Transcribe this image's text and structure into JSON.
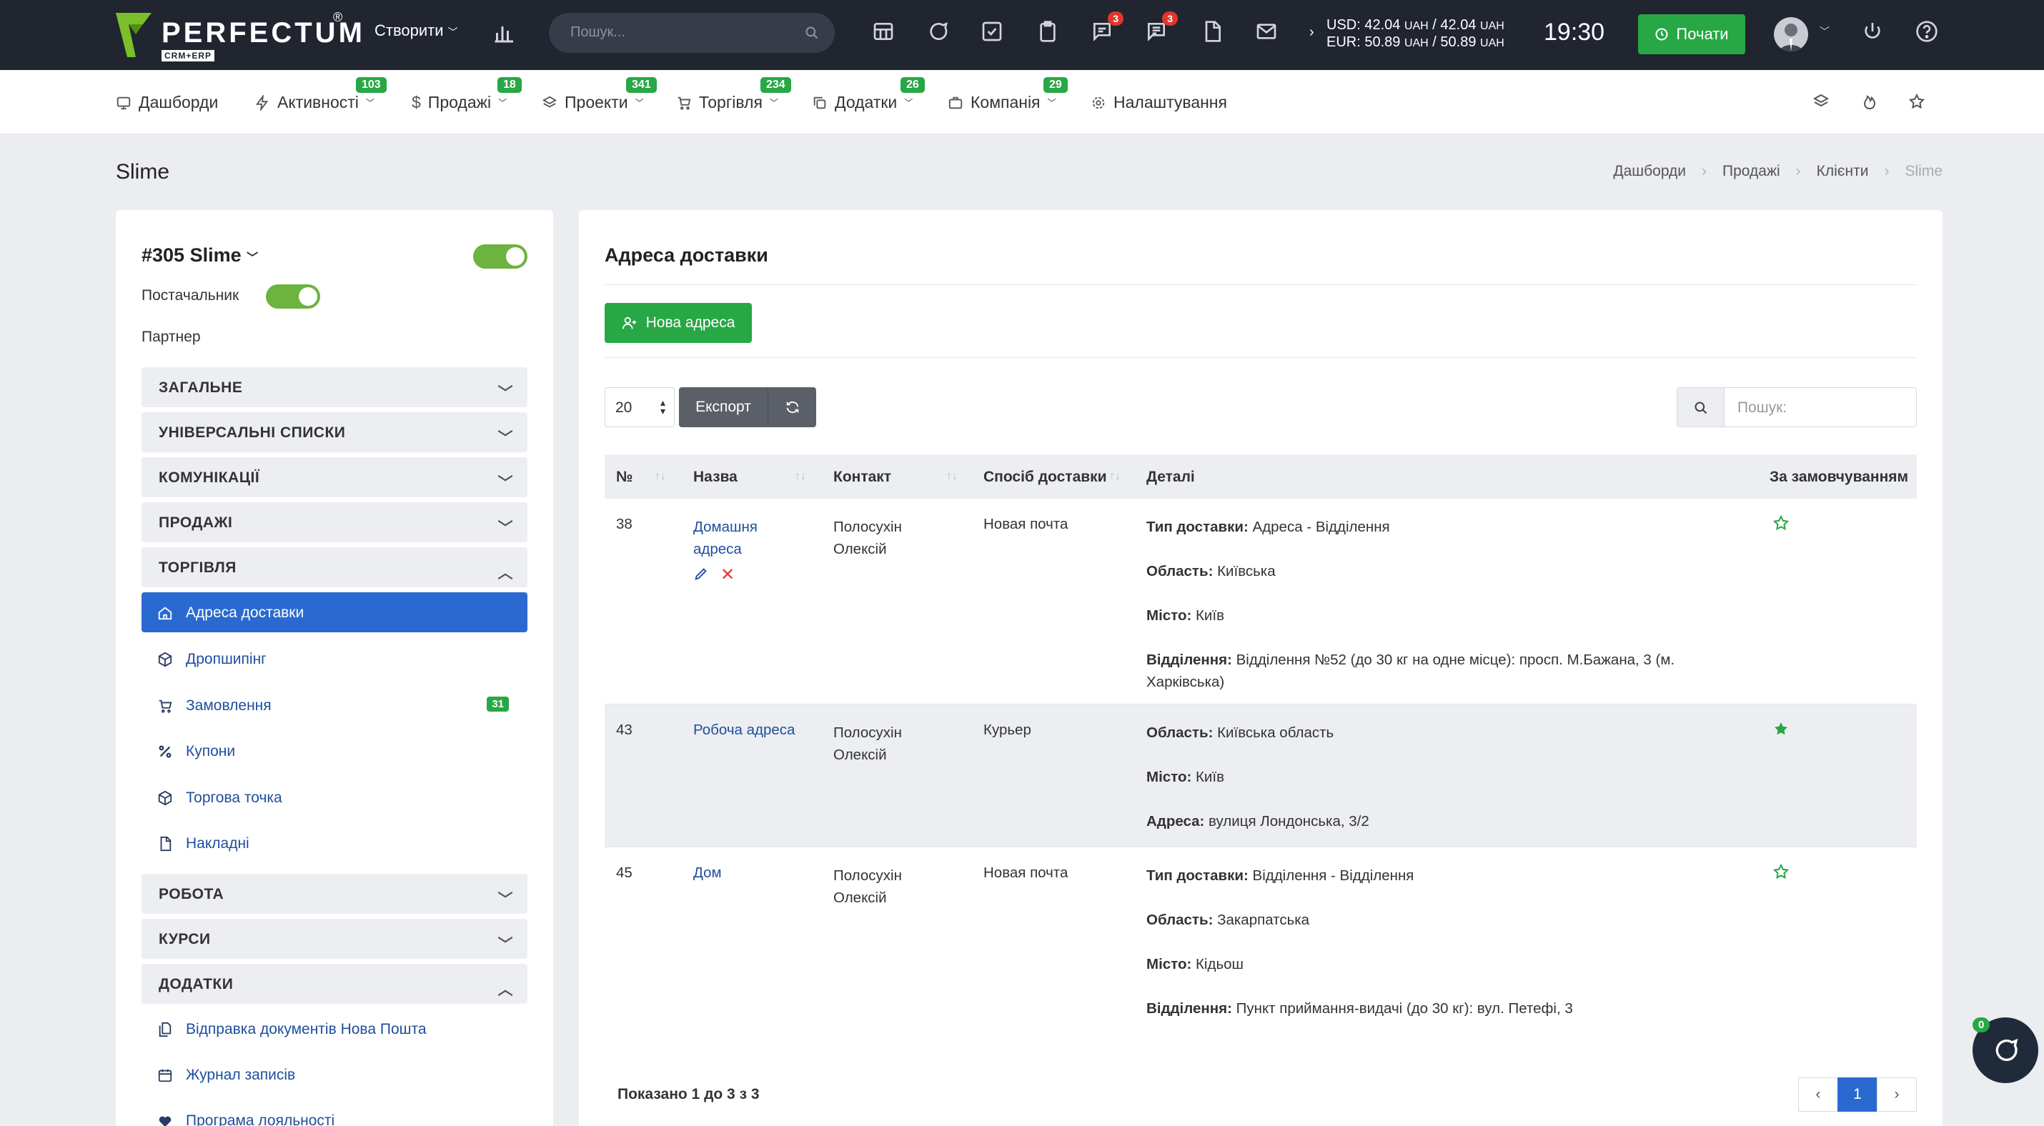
{
  "app": {
    "logo": "PERFECTUM",
    "logo_sub": "CRM+ERP",
    "logo_reg": "®",
    "create_label": "Створити",
    "search_placeholder": "Пошук...",
    "notif_badge_1": "3",
    "notif_badge_2": "3",
    "rate_usd": "USD: 42.04",
    "rate_usd_mid": " / 42.04 ",
    "rate_eur": "EUR: 50.89",
    "rate_eur_mid": " / 50.89 ",
    "uah": "UAH",
    "time": "19:30",
    "start_label": "Почати"
  },
  "nav": [
    {
      "label": "Дашборди",
      "badge": ""
    },
    {
      "label": "Активності",
      "badge": "103"
    },
    {
      "label": "Продажі",
      "badge": "18"
    },
    {
      "label": "Проекти",
      "badge": "341"
    },
    {
      "label": "Торгівля",
      "badge": "234"
    },
    {
      "label": "Додатки",
      "badge": "26"
    },
    {
      "label": "Компанія",
      "badge": "29"
    },
    {
      "label": "Налаштування",
      "badge": ""
    }
  ],
  "page": {
    "title": "Slime",
    "breadcrumbs": [
      "Дашборди",
      "Продажі",
      "Клієнти",
      "Slime"
    ]
  },
  "client": {
    "name": "#305 Slime",
    "supplier_label": "Постачальник",
    "partner_label": "Партнер"
  },
  "sidebar": {
    "sections": [
      "ЗАГАЛЬНЕ",
      "УНІВЕРСАЛЬНІ СПИСКИ",
      "КОМУНІКАЦІЇ",
      "ПРОДАЖІ",
      "ТОРГІВЛЯ",
      "РОБОТА",
      "КУРСИ",
      "ДОДАТКИ"
    ],
    "trade_items": [
      "Адреса доставки",
      "Дропшипінг",
      "Замовлення",
      "Купони",
      "Торгова точка",
      "Накладні"
    ],
    "orders_badge": "31",
    "addon_items": [
      "Відправка документів Нова Пошта",
      "Журнал записів",
      "Програма лояльності"
    ]
  },
  "main": {
    "title": "Адреса доставки",
    "new_address_label": "Нова адреса",
    "page_size": "20",
    "export_label": "Експорт",
    "search_placeholder": "Пошук:",
    "columns": [
      "№",
      "Назва",
      "Контакт",
      "Спосіб доставки",
      "Деталі",
      "За замовчуванням"
    ],
    "rows": [
      {
        "id": "38",
        "name_1": "Домашня",
        "name_2": "адреса",
        "contact_1": "Полосухін",
        "contact_2": "Олексій",
        "method": "Новая почта",
        "d1_label": "Тип доставки:",
        "d1_value": " Адреса - Відділення",
        "d2_label": "Область:",
        "d2_value": " Київська",
        "d3_label": "Місто:",
        "d3_value": " Київ",
        "d4_label": "Відділення:",
        "d4_value_1": " Відділення №52 (до 30 кг на одне місце): просп. М.Бажана, 3 (м.",
        "d4_value_2": "Харківська)",
        "default": false
      },
      {
        "id": "43",
        "name_1": "Робоча адреса",
        "contact_1": "Полосухін",
        "contact_2": "Олексій",
        "method": "Курьер",
        "d1_label": "Область:",
        "d1_value": " Київська область",
        "d2_label": "Місто:",
        "d2_value": " Київ",
        "d3_label": "Адреса:",
        "d3_value": " вулиця Лондонська, 3/2",
        "default": true
      },
      {
        "id": "45",
        "name_1": "Дом",
        "contact_1": "Полосухін",
        "contact_2": "Олексій",
        "method": "Новая почта",
        "d1_label": "Тип доставки:",
        "d1_value": " Відділення - Відділення",
        "d2_label": "Область:",
        "d2_value": " Закарпатська",
        "d3_label": "Місто:",
        "d3_value": " Кідьош",
        "d4_label": "Відділення:",
        "d4_value_1": " Пункт приймання-видачі (до 30 кг): вул. Петефі, 3",
        "default": false
      }
    ],
    "footer_info": "Показано 1 до 3 з 3",
    "current_page": "1"
  },
  "chat_badge": "0",
  "colors": {
    "accent": "#28a745",
    "primary": "#2a6ad0",
    "topbar": "#202530"
  }
}
